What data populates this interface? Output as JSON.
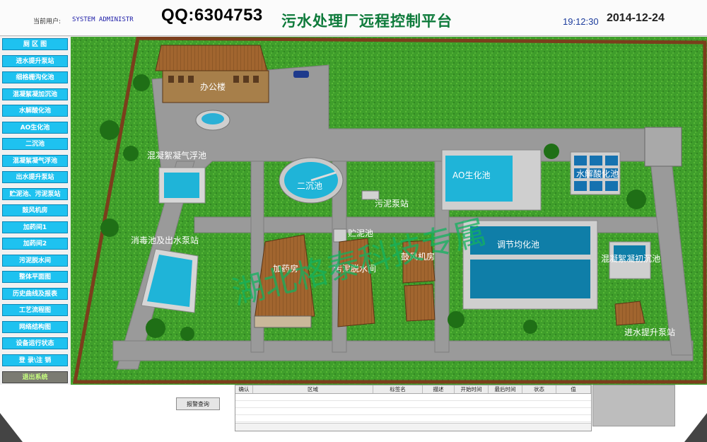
{
  "header": {
    "user_label": "当前用户:",
    "user_name": "SYSTEM ADMINISTR",
    "qq_watermark": "QQ:6304753",
    "title": "污水处理厂远程控制平台",
    "time": "19:12:30",
    "date": "2014-12-24"
  },
  "sidebar": {
    "items": [
      {
        "label": "厕 区 图"
      },
      {
        "label": "进水提升泵站"
      },
      {
        "label": "细格栅沟化池"
      },
      {
        "label": "混凝絮凝加沉池"
      },
      {
        "label": "水解酸化池"
      },
      {
        "label": "AO生化池"
      },
      {
        "label": "二沉池"
      },
      {
        "label": "混凝絮凝气浮池"
      },
      {
        "label": "出水提升泵站"
      },
      {
        "label": "贮泥池、污泥泵站"
      },
      {
        "label": "鼓风机房"
      },
      {
        "label": "加药间1"
      },
      {
        "label": "加药间2"
      },
      {
        "label": "污泥脱水间"
      },
      {
        "label": "整体平面图"
      },
      {
        "label": "历史曲线及报表"
      },
      {
        "label": "工艺流程图"
      },
      {
        "label": "网络结构图"
      },
      {
        "label": "设备运行状态"
      },
      {
        "label": "登 录\\注 销"
      },
      {
        "label": "退出系统"
      }
    ]
  },
  "plant": {
    "labels": {
      "office": "办公楼",
      "flotation": "混凝絮凝气浮池",
      "secondary_clarifier": "二沉池",
      "ao_tank": "AO生化池",
      "hydrolysis": "水解酸化池",
      "sludge_pump": "污泥泵站",
      "sludge_storage": "贮泥池",
      "disinfection": "消毒池及出水泵站",
      "dosing": "加药房",
      "dewatering": "污泥脱水间",
      "blower": "鼓风机房",
      "equalization": "调节均化池",
      "primary_settling": "混凝絮凝初沉池",
      "inlet_pump": "进水提升泵站"
    },
    "watermark": "湖北格泰科技专属"
  },
  "alarm": {
    "query_button": "报警查询",
    "columns": [
      "确认",
      "区域",
      "标签名",
      "描述",
      "开始时间",
      "最后时间",
      "状态",
      "值"
    ]
  }
}
